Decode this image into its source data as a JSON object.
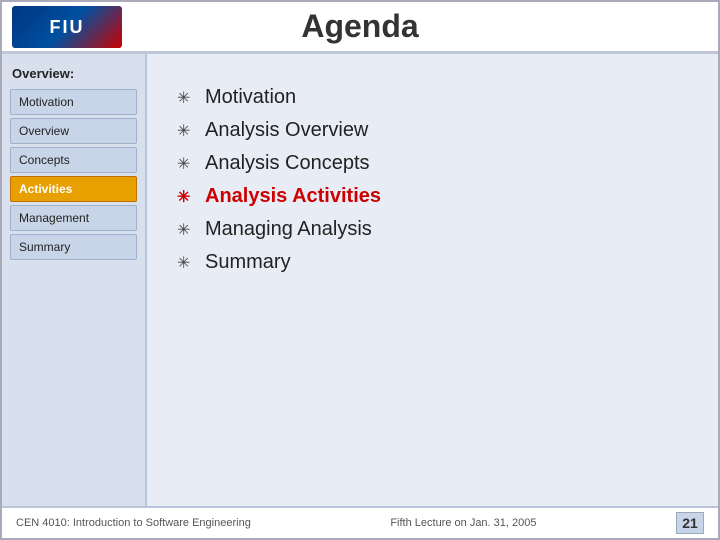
{
  "header": {
    "title": "Agenda",
    "logo_text": "FIU"
  },
  "sidebar": {
    "heading": "Overview:",
    "items": [
      {
        "label": "Motivation",
        "active": false
      },
      {
        "label": "Overview",
        "active": false
      },
      {
        "label": "Concepts",
        "active": false
      },
      {
        "label": "Activities",
        "active": true
      },
      {
        "label": "Management",
        "active": false
      },
      {
        "label": "Summary",
        "active": false
      }
    ]
  },
  "agenda": {
    "items": [
      {
        "text": "Motivation",
        "highlight": false
      },
      {
        "text": "Analysis Overview",
        "highlight": false
      },
      {
        "text": "Analysis Concepts",
        "highlight": false
      },
      {
        "text": "Analysis Activities",
        "highlight": true
      },
      {
        "text": "Managing Analysis",
        "highlight": false
      },
      {
        "text": "Summary",
        "highlight": false
      }
    ]
  },
  "footer": {
    "left": "CEN 4010: Introduction to Software Engineering",
    "right_label": "Fifth Lecture on Jan. 31, 2005",
    "page_number": "21"
  }
}
